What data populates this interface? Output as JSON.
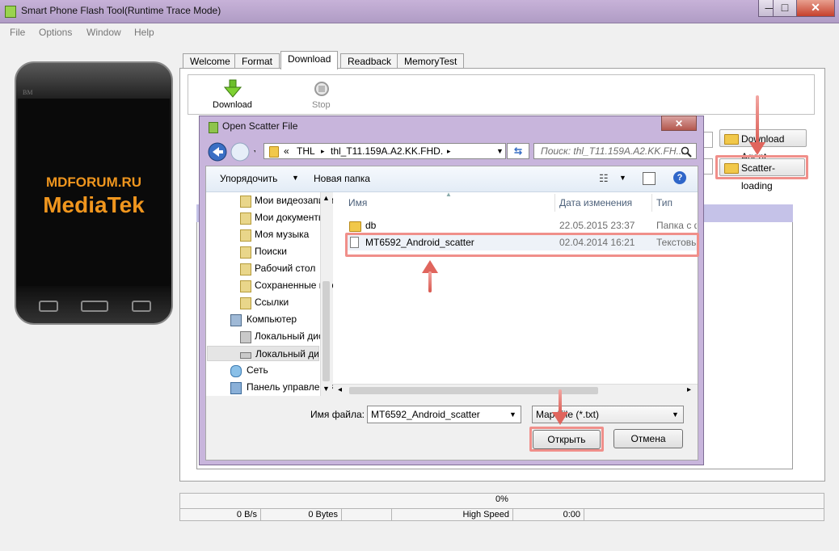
{
  "window": {
    "title": "Smart Phone Flash Tool(Runtime Trace Mode)",
    "min": "—",
    "max": "□",
    "close": "✕"
  },
  "menu": [
    "File",
    "Options",
    "Window",
    "Help"
  ],
  "phone": {
    "brand": "BM",
    "line1": "MDFORUM.RU",
    "line2": "MediaTek"
  },
  "tabs": [
    "Welcome",
    "Format",
    "Download",
    "Readback",
    "MemoryTest"
  ],
  "toolbar": {
    "download": "Download",
    "stop": "Stop"
  },
  "side_buttons": {
    "download_agent": "Download Agent",
    "scatter_loading": "Scatter-loading"
  },
  "status": {
    "progress": "0%",
    "speed": "0 B/s",
    "bytes": "0 Bytes",
    "mode": "High Speed",
    "time": "0:00"
  },
  "dialog": {
    "title": "Open Scatter File",
    "close": "✕",
    "address": [
      "«",
      "THL",
      "thl_T11.159A.A2.KK.FHD..."
    ],
    "search_placeholder": "Поиск: thl_T11.159A.A2.KK.FH...",
    "organize": "Упорядочить",
    "new_folder": "Новая папка",
    "nav": [
      "Мои видеозаписи",
      "Мои документы",
      "Моя музыка",
      "Поиски",
      "Рабочий стол",
      "Сохраненные игры",
      "Ссылки",
      "Компьютер",
      "Локальный диск",
      "Локальный диск",
      "Сеть",
      "Панель управления"
    ],
    "columns": {
      "name": "Имя",
      "date": "Дата изменения",
      "type": "Тип"
    },
    "files": [
      {
        "name": "db",
        "date": "22.05.2015 23:37",
        "type": "Папка с ф"
      },
      {
        "name": "MT6592_Android_scatter",
        "date": "02.04.2014 16:21",
        "type": "Текстовь"
      }
    ],
    "filename_label": "Имя файла:",
    "filename_value": "MT6592_Android_scatter",
    "filter_value": "Map File (*.txt)",
    "open": "Открыть",
    "cancel": "Отмена"
  }
}
